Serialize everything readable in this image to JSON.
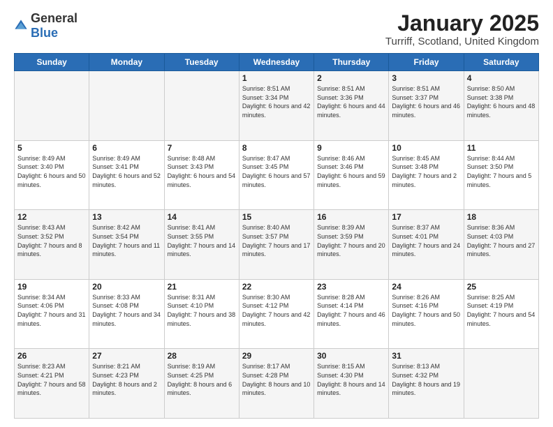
{
  "logo": {
    "general": "General",
    "blue": "Blue"
  },
  "header": {
    "month": "January 2025",
    "location": "Turriff, Scotland, United Kingdom"
  },
  "days_of_week": [
    "Sunday",
    "Monday",
    "Tuesday",
    "Wednesday",
    "Thursday",
    "Friday",
    "Saturday"
  ],
  "weeks": [
    [
      {
        "day": "",
        "info": ""
      },
      {
        "day": "",
        "info": ""
      },
      {
        "day": "",
        "info": ""
      },
      {
        "day": "1",
        "info": "Sunrise: 8:51 AM\nSunset: 3:34 PM\nDaylight: 6 hours and 42 minutes."
      },
      {
        "day": "2",
        "info": "Sunrise: 8:51 AM\nSunset: 3:36 PM\nDaylight: 6 hours and 44 minutes."
      },
      {
        "day": "3",
        "info": "Sunrise: 8:51 AM\nSunset: 3:37 PM\nDaylight: 6 hours and 46 minutes."
      },
      {
        "day": "4",
        "info": "Sunrise: 8:50 AM\nSunset: 3:38 PM\nDaylight: 6 hours and 48 minutes."
      }
    ],
    [
      {
        "day": "5",
        "info": "Sunrise: 8:49 AM\nSunset: 3:40 PM\nDaylight: 6 hours and 50 minutes."
      },
      {
        "day": "6",
        "info": "Sunrise: 8:49 AM\nSunset: 3:41 PM\nDaylight: 6 hours and 52 minutes."
      },
      {
        "day": "7",
        "info": "Sunrise: 8:48 AM\nSunset: 3:43 PM\nDaylight: 6 hours and 54 minutes."
      },
      {
        "day": "8",
        "info": "Sunrise: 8:47 AM\nSunset: 3:45 PM\nDaylight: 6 hours and 57 minutes."
      },
      {
        "day": "9",
        "info": "Sunrise: 8:46 AM\nSunset: 3:46 PM\nDaylight: 6 hours and 59 minutes."
      },
      {
        "day": "10",
        "info": "Sunrise: 8:45 AM\nSunset: 3:48 PM\nDaylight: 7 hours and 2 minutes."
      },
      {
        "day": "11",
        "info": "Sunrise: 8:44 AM\nSunset: 3:50 PM\nDaylight: 7 hours and 5 minutes."
      }
    ],
    [
      {
        "day": "12",
        "info": "Sunrise: 8:43 AM\nSunset: 3:52 PM\nDaylight: 7 hours and 8 minutes."
      },
      {
        "day": "13",
        "info": "Sunrise: 8:42 AM\nSunset: 3:54 PM\nDaylight: 7 hours and 11 minutes."
      },
      {
        "day": "14",
        "info": "Sunrise: 8:41 AM\nSunset: 3:55 PM\nDaylight: 7 hours and 14 minutes."
      },
      {
        "day": "15",
        "info": "Sunrise: 8:40 AM\nSunset: 3:57 PM\nDaylight: 7 hours and 17 minutes."
      },
      {
        "day": "16",
        "info": "Sunrise: 8:39 AM\nSunset: 3:59 PM\nDaylight: 7 hours and 20 minutes."
      },
      {
        "day": "17",
        "info": "Sunrise: 8:37 AM\nSunset: 4:01 PM\nDaylight: 7 hours and 24 minutes."
      },
      {
        "day": "18",
        "info": "Sunrise: 8:36 AM\nSunset: 4:03 PM\nDaylight: 7 hours and 27 minutes."
      }
    ],
    [
      {
        "day": "19",
        "info": "Sunrise: 8:34 AM\nSunset: 4:06 PM\nDaylight: 7 hours and 31 minutes."
      },
      {
        "day": "20",
        "info": "Sunrise: 8:33 AM\nSunset: 4:08 PM\nDaylight: 7 hours and 34 minutes."
      },
      {
        "day": "21",
        "info": "Sunrise: 8:31 AM\nSunset: 4:10 PM\nDaylight: 7 hours and 38 minutes."
      },
      {
        "day": "22",
        "info": "Sunrise: 8:30 AM\nSunset: 4:12 PM\nDaylight: 7 hours and 42 minutes."
      },
      {
        "day": "23",
        "info": "Sunrise: 8:28 AM\nSunset: 4:14 PM\nDaylight: 7 hours and 46 minutes."
      },
      {
        "day": "24",
        "info": "Sunrise: 8:26 AM\nSunset: 4:16 PM\nDaylight: 7 hours and 50 minutes."
      },
      {
        "day": "25",
        "info": "Sunrise: 8:25 AM\nSunset: 4:19 PM\nDaylight: 7 hours and 54 minutes."
      }
    ],
    [
      {
        "day": "26",
        "info": "Sunrise: 8:23 AM\nSunset: 4:21 PM\nDaylight: 7 hours and 58 minutes."
      },
      {
        "day": "27",
        "info": "Sunrise: 8:21 AM\nSunset: 4:23 PM\nDaylight: 8 hours and 2 minutes."
      },
      {
        "day": "28",
        "info": "Sunrise: 8:19 AM\nSunset: 4:25 PM\nDaylight: 8 hours and 6 minutes."
      },
      {
        "day": "29",
        "info": "Sunrise: 8:17 AM\nSunset: 4:28 PM\nDaylight: 8 hours and 10 minutes."
      },
      {
        "day": "30",
        "info": "Sunrise: 8:15 AM\nSunset: 4:30 PM\nDaylight: 8 hours and 14 minutes."
      },
      {
        "day": "31",
        "info": "Sunrise: 8:13 AM\nSunset: 4:32 PM\nDaylight: 8 hours and 19 minutes."
      },
      {
        "day": "",
        "info": ""
      }
    ]
  ]
}
